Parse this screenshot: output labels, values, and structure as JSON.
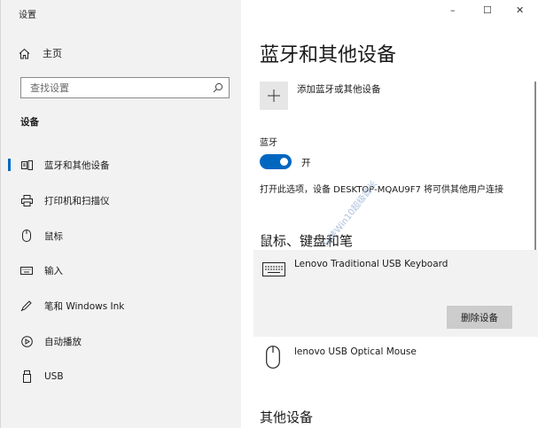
{
  "window": {
    "title": "设置",
    "minimize": "–",
    "maximize": "☐",
    "close": "✕"
  },
  "sidebar": {
    "home_label": "主页",
    "search_placeholder": "查找设置",
    "section_label": "设备",
    "items": [
      {
        "label": "蓝牙和其他设备",
        "icon": "bluetooth-devices-icon",
        "active": true
      },
      {
        "label": "打印机和扫描仪",
        "icon": "printer-icon",
        "active": false
      },
      {
        "label": "鼠标",
        "icon": "mouse-icon",
        "active": false
      },
      {
        "label": "输入",
        "icon": "keyboard-icon",
        "active": false
      },
      {
        "label": "笔和 Windows Ink",
        "icon": "pen-icon",
        "active": false
      },
      {
        "label": "自动播放",
        "icon": "autoplay-icon",
        "active": false
      },
      {
        "label": "USB",
        "icon": "usb-icon",
        "active": false
      }
    ]
  },
  "main": {
    "title": "蓝牙和其他设备",
    "add_label": "添加蓝牙或其他设备",
    "bluetooth_label": "蓝牙",
    "toggle_state": "开",
    "description": "打开此选项，设备 DESKTOP-MQAU9F7 将可供其他用户连接",
    "section_mouse_keyboard": "鼠标、键盘和笔",
    "devices": [
      {
        "name": "Lenovo Traditional USB Keyboard",
        "icon": "keyboard-icon"
      },
      {
        "name": "lenovo USB Optical Mouse",
        "icon": "mouse-icon"
      }
    ],
    "remove_label": "删除设备",
    "section_other": "其他设备",
    "watermark": "玩转Win10超级酋长"
  },
  "colors": {
    "accent": "#0067c0",
    "sidebar_bg": "#f2f2f2",
    "button_bg": "#cccccc"
  }
}
